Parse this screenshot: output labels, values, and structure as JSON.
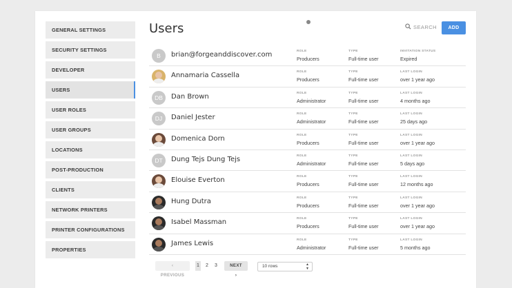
{
  "sidebar": {
    "items": [
      {
        "label": "GENERAL SETTINGS"
      },
      {
        "label": "SECURITY SETTINGS"
      },
      {
        "label": "DEVELOPER"
      },
      {
        "label": "USERS"
      },
      {
        "label": "USER ROLES"
      },
      {
        "label": "USER GROUPS"
      },
      {
        "label": "LOCATIONS"
      },
      {
        "label": "POST-PRODUCTION"
      },
      {
        "label": "CLIENTS"
      },
      {
        "label": "NETWORK PRINTERS"
      },
      {
        "label": "PRINTER CONFIGURATIONS"
      },
      {
        "label": "PROPERTIES"
      }
    ],
    "active_index": 3
  },
  "header": {
    "title": "Users",
    "search_label": "SEARCH",
    "add_label": "ADD"
  },
  "labels": {
    "role": "ROLE",
    "type": "TYPE",
    "invitation_status": "INVITATION STATUS",
    "last_login": "LAST LOGIN"
  },
  "users": [
    {
      "name": "brian@forgeanddiscover.com",
      "initials": "B",
      "role": "Producers",
      "type": "Full-time user",
      "status_label": "INVITATION STATUS",
      "status": "Expired",
      "avatar": "initials"
    },
    {
      "name": "Annamaria Cassella",
      "initials": "",
      "role": "Producers",
      "type": "Full-time user",
      "status_label": "LAST LOGIN",
      "status": "over 1 year ago",
      "avatar": "blond"
    },
    {
      "name": "Dan Brown",
      "initials": "DB",
      "role": "Administrator",
      "type": "Full-time user",
      "status_label": "LAST LOGIN",
      "status": "4 months ago",
      "avatar": "initials"
    },
    {
      "name": "Daniel Jester",
      "initials": "DJ",
      "role": "Administrator",
      "type": "Full-time user",
      "status_label": "LAST LOGIN",
      "status": "25 days ago",
      "avatar": "initials"
    },
    {
      "name": "Domenica Dorn",
      "initials": "",
      "role": "Producers",
      "type": "Full-time user",
      "status_label": "LAST LOGIN",
      "status": "over 1 year ago",
      "avatar": "photo"
    },
    {
      "name": "Dung Tejs Dung Tejs",
      "initials": "DT",
      "role": "Administrator",
      "type": "Full-time user",
      "status_label": "LAST LOGIN",
      "status": "5 days ago",
      "avatar": "initials"
    },
    {
      "name": "Elouise Everton",
      "initials": "",
      "role": "Producers",
      "type": "Full-time user",
      "status_label": "LAST LOGIN",
      "status": "12 months ago",
      "avatar": "photo"
    },
    {
      "name": "Hung Dutra",
      "initials": "",
      "role": "Producers",
      "type": "Full-time user",
      "status_label": "LAST LOGIN",
      "status": "over 1 year ago",
      "avatar": "dark"
    },
    {
      "name": "Isabel Massman",
      "initials": "",
      "role": "Producers",
      "type": "Full-time user",
      "status_label": "LAST LOGIN",
      "status": "over 1 year ago",
      "avatar": "dark"
    },
    {
      "name": "James Lewis",
      "initials": "",
      "role": "Administrator",
      "type": "Full-time user",
      "status_label": "LAST LOGIN",
      "status": "5 months ago",
      "avatar": "dark"
    }
  ],
  "pagination": {
    "previous_label": "PREVIOUS",
    "pages": [
      "1",
      "2",
      "3"
    ],
    "current_page": "1",
    "next_label": "NEXT",
    "rows_per_page": "10 rows"
  },
  "colors": {
    "accent": "#4a90e2"
  }
}
